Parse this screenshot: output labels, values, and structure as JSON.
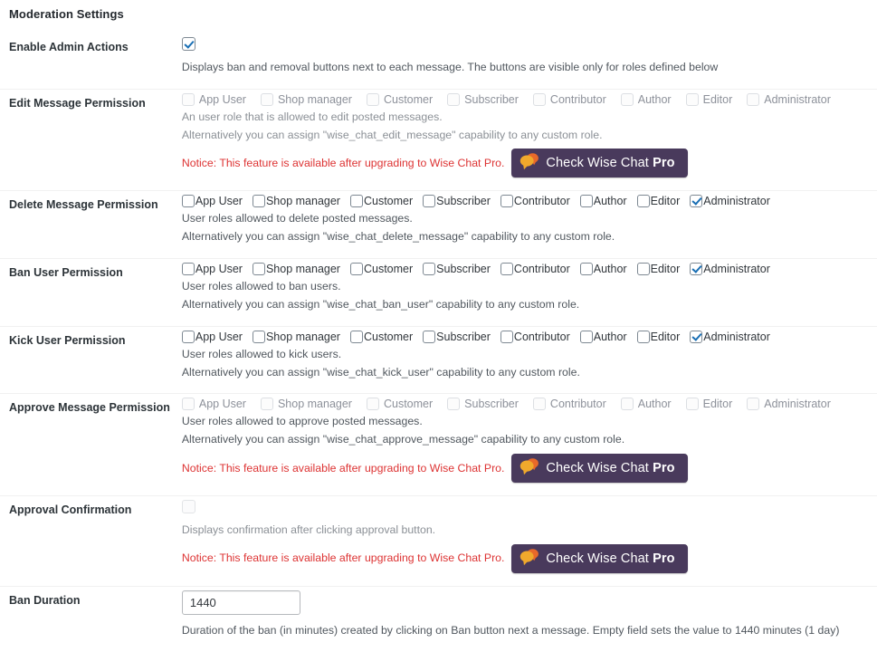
{
  "page": {
    "section_title": "Moderation Settings"
  },
  "roles": [
    "App User",
    "Shop manager",
    "Customer",
    "Subscriber",
    "Contributor",
    "Author",
    "Editor",
    "Administrator"
  ],
  "pro_button": {
    "label_normal": "Check Wise Chat ",
    "label_bold": "Pro",
    "icon": "speech-bubbles-icon",
    "bg_color": "#493a5c",
    "bubble_back_color": "#e8692a",
    "bubble_front_color": "#f0a92c"
  },
  "notice": {
    "text": "Notice: This feature is available after upgrading to Wise Chat Pro.",
    "color": "#dd3333"
  },
  "rows": {
    "enable_admin_actions": {
      "label": "Enable Admin Actions",
      "checked": true,
      "desc": "Displays ban and removal buttons next to each message. The buttons are visible only for roles defined below"
    },
    "edit_message_permission": {
      "label": "Edit Message Permission",
      "enabled": false,
      "checked_roles": [],
      "desc1": "An user role that is allowed to edit posted messages.",
      "desc2": "Alternatively you can assign \"wise_chat_edit_message\" capability to any custom role.",
      "has_notice": true
    },
    "delete_message_permission": {
      "label": "Delete Message Permission",
      "enabled": true,
      "checked_roles": [
        "Administrator"
      ],
      "desc1": "User roles allowed to delete posted messages.",
      "desc2": "Alternatively you can assign \"wise_chat_delete_message\" capability to any custom role.",
      "has_notice": false
    },
    "ban_user_permission": {
      "label": "Ban User Permission",
      "enabled": true,
      "checked_roles": [
        "Administrator"
      ],
      "desc1": "User roles allowed to ban users.",
      "desc2": "Alternatively you can assign \"wise_chat_ban_user\" capability to any custom role.",
      "has_notice": false
    },
    "kick_user_permission": {
      "label": "Kick User Permission",
      "enabled": true,
      "checked_roles": [
        "Administrator"
      ],
      "desc1": "User roles allowed to kick users.",
      "desc2": "Alternatively you can assign \"wise_chat_kick_user\" capability to any custom role.",
      "has_notice": false
    },
    "approve_message_permission": {
      "label": "Approve Message Permission",
      "enabled": false,
      "checked_roles": [],
      "desc1": "User roles allowed to approve posted messages.",
      "desc2": "Alternatively you can assign \"wise_chat_approve_message\" capability to any custom role.",
      "has_notice": true
    },
    "approval_confirmation": {
      "label": "Approval Confirmation",
      "checked": false,
      "enabled": false,
      "desc": "Displays confirmation after clicking approval button.",
      "has_notice": true
    },
    "ban_duration": {
      "label": "Ban Duration",
      "value": "1440",
      "desc": "Duration of the ban (in minutes) created by clicking on Ban button next a message. Empty field sets the value to 1440 minutes (1 day)"
    }
  }
}
